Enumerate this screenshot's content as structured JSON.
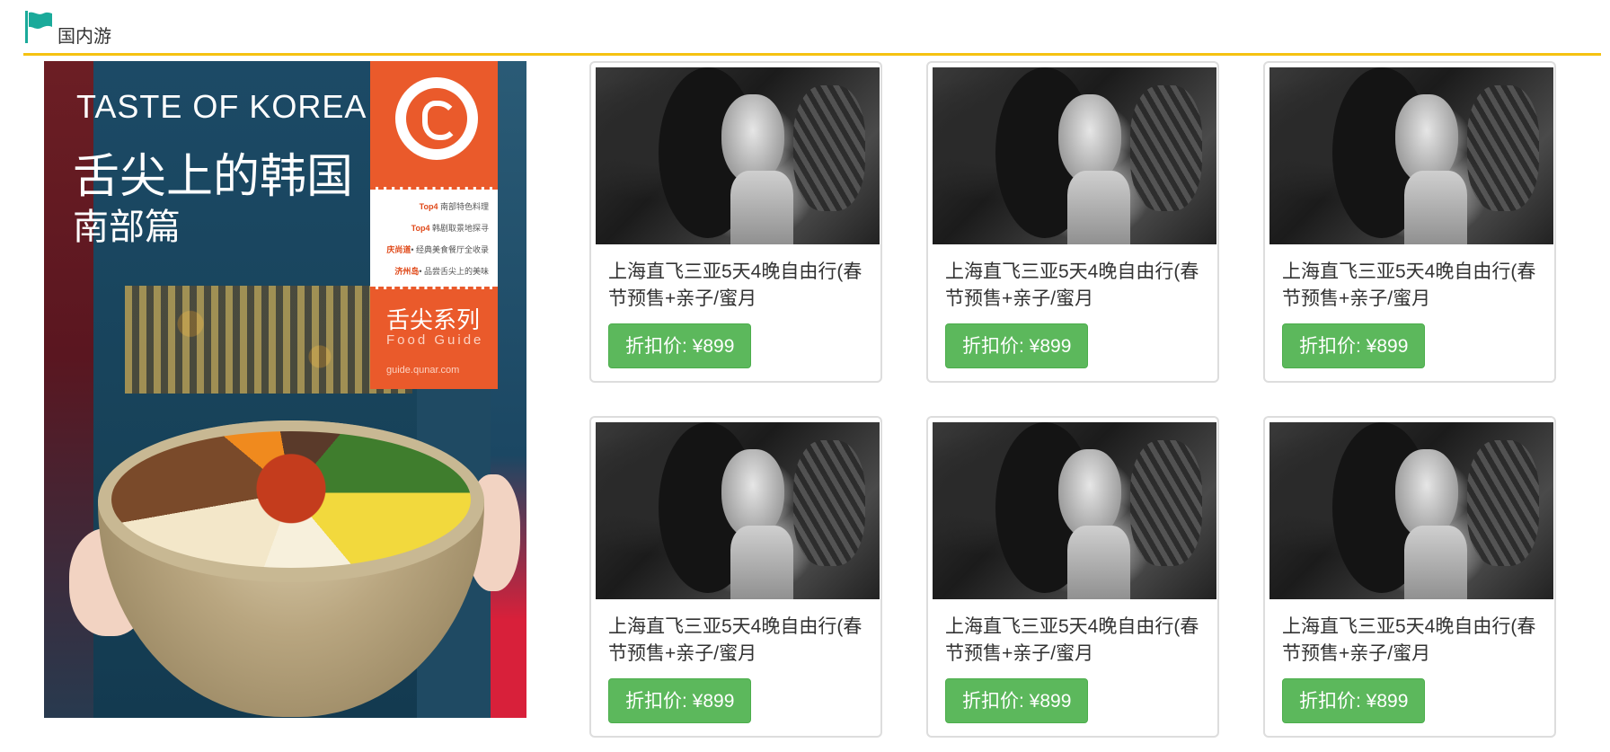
{
  "section": {
    "title": "国内游",
    "accent_color": "#f5c211",
    "flag_color": "#1aaa9a"
  },
  "promo": {
    "headline_en": "TASTE OF KOREA",
    "headline_cn": "舌尖上的韩国",
    "subhead_cn": "南部篇",
    "notes": [
      {
        "tag": "Top4",
        "text": "南部特色料理"
      },
      {
        "tag": "Top4",
        "text": "韩剧取景地探寻"
      },
      {
        "tag": "庆尚道",
        "text": "• 经典美食餐厅全收录"
      },
      {
        "tag": "济州岛",
        "text": "• 品尝舌尖上的美味"
      }
    ],
    "series_cn": "舌尖系列",
    "series_en": "Food Guide",
    "site": "guide.qunar.com"
  },
  "products": [
    {
      "title": "上海直飞三亚5天4晚自由行(春节预售+亲子/蜜月",
      "price_label": "折扣价: ¥899"
    },
    {
      "title": "上海直飞三亚5天4晚自由行(春节预售+亲子/蜜月",
      "price_label": "折扣价: ¥899"
    },
    {
      "title": "上海直飞三亚5天4晚自由行(春节预售+亲子/蜜月",
      "price_label": "折扣价: ¥899"
    },
    {
      "title": "上海直飞三亚5天4晚自由行(春节预售+亲子/蜜月",
      "price_label": "折扣价: ¥899"
    },
    {
      "title": "上海直飞三亚5天4晚自由行(春节预售+亲子/蜜月",
      "price_label": "折扣价: ¥899"
    },
    {
      "title": "上海直飞三亚5天4晚自由行(春节预售+亲子/蜜月",
      "price_label": "折扣价: ¥899"
    }
  ],
  "colors": {
    "button_green": "#5cb85c",
    "promo_orange": "#ea5a2b"
  }
}
